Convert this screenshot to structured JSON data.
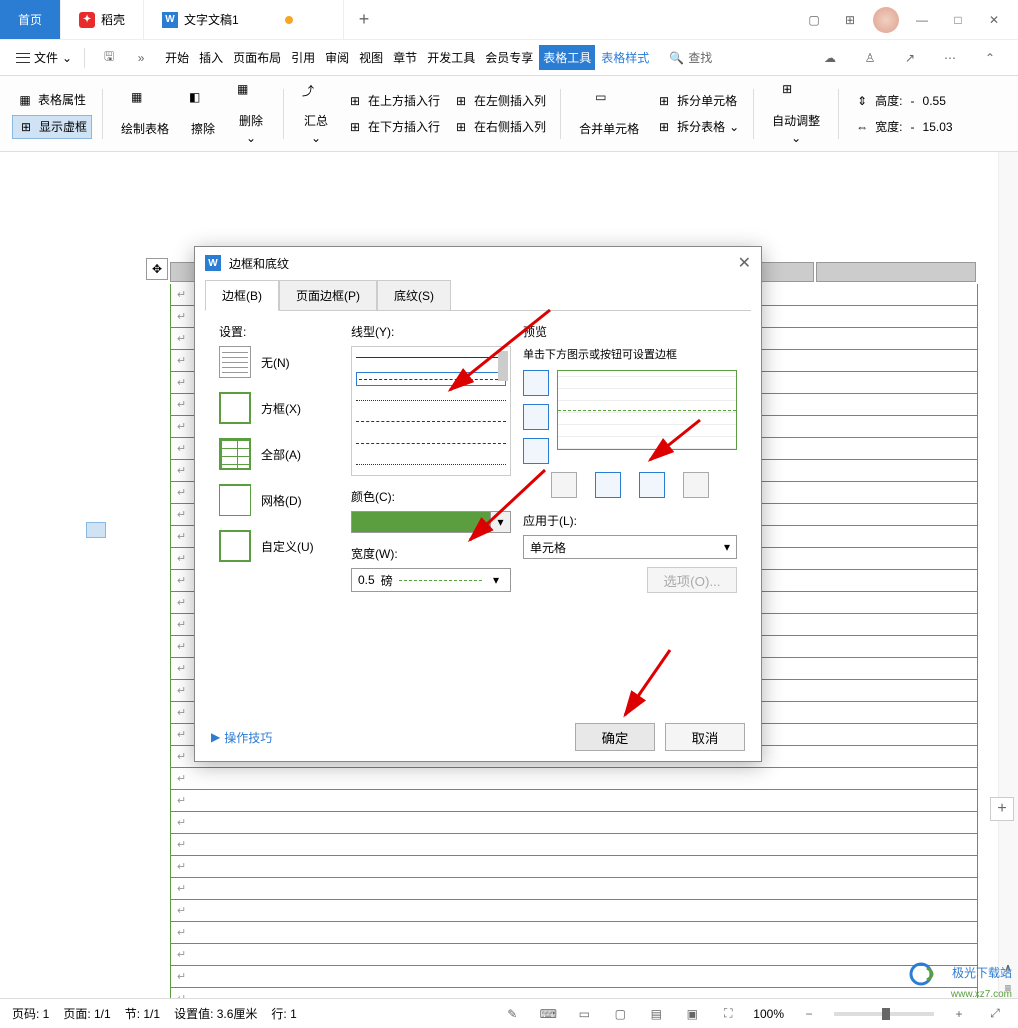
{
  "titlebar": {
    "home": "首页",
    "doke": "稻壳",
    "doc": "文字文稿1",
    "plus": "+"
  },
  "menubar": {
    "file": "文件",
    "items": [
      "开始",
      "插入",
      "页面布局",
      "引用",
      "审阅",
      "视图",
      "章节",
      "开发工具",
      "会员专享",
      "表格工具",
      "表格样式"
    ],
    "search": "查找"
  },
  "ribbon": {
    "table_props": "表格属性",
    "show_grid": "显示虚框",
    "draw": "绘制表格",
    "erase": "擦除",
    "delete": "删除",
    "summary": "汇总",
    "insert_above": "在上方插入行",
    "insert_below": "在下方插入行",
    "insert_left": "在左侧插入列",
    "insert_right": "在右侧插入列",
    "merge": "合并单元格",
    "split_cell": "拆分单元格",
    "split_table": "拆分表格",
    "auto_fit": "自动调整",
    "height": "高度:",
    "height_val": "0.55",
    "width": "宽度:",
    "width_val": "15.03"
  },
  "dialog": {
    "title": "边框和底纹",
    "tabs": {
      "border": "边框(B)",
      "page_border": "页面边框(P)",
      "shading": "底纹(S)"
    },
    "setting_label": "设置:",
    "settings": {
      "none": "无(N)",
      "box": "方框(X)",
      "all": "全部(A)",
      "grid": "网格(D)",
      "custom": "自定义(U)"
    },
    "style_label": "线型(Y):",
    "color_label": "颜色(C):",
    "width_label": "宽度(W):",
    "width_value": "0.5",
    "width_unit": "磅",
    "preview_label": "预览",
    "preview_hint": "单击下方图示或按钮可设置边框",
    "apply_label": "应用于(L):",
    "apply_value": "单元格",
    "options": "选项(O)...",
    "tips": "操作技巧",
    "ok": "确定",
    "cancel": "取消",
    "color_value": "#5a9e3f"
  },
  "statusbar": {
    "page": "页码: 1",
    "pages": "页面: 1/1",
    "section": "节: 1/1",
    "pos": "设置值: 3.6厘米",
    "line": "行: 1",
    "zoom": "100%"
  },
  "watermark": {
    "name": "极光下载站",
    "url": "www.xz7.com"
  }
}
